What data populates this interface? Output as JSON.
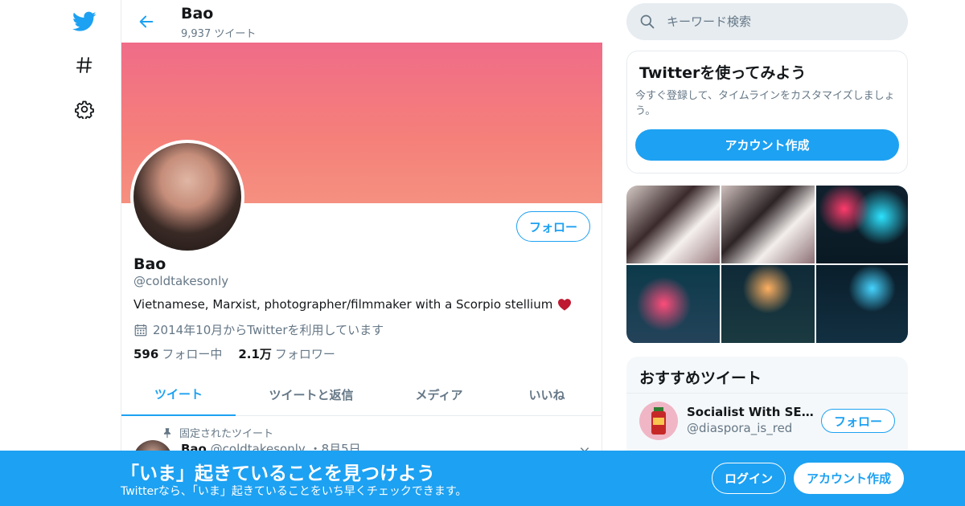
{
  "colors": {
    "accent": "#1da1f2",
    "muted": "#657786",
    "heart": "#be1931"
  },
  "header": {
    "title": "Bao",
    "tweet_count": "9,937 ツイート"
  },
  "profile": {
    "name": "Bao",
    "handle": "@coldtakesonly",
    "bio": "Vietnamese, Marxist, photographer/filmmaker with a Scorpio stellium",
    "joined": "2014年10月からTwitterを利用しています",
    "following_count": "596",
    "following_label": "フォロー中",
    "followers_count": "2.1万",
    "followers_label": "フォロワー",
    "follow_label": "フォロー"
  },
  "tabs": [
    {
      "label": "ツイート",
      "active": true
    },
    {
      "label": "ツイートと返信",
      "active": false
    },
    {
      "label": "メディア",
      "active": false
    },
    {
      "label": "いいね",
      "active": false
    }
  ],
  "pinned": {
    "label": "固定されたツイート",
    "author": "Bao",
    "handle": "@coldtakesonly",
    "date": "・8月5日"
  },
  "search": {
    "placeholder": "キーワード検索"
  },
  "signup_card": {
    "title": "Twitterを使ってみよう",
    "description": "今すぐ登録して、タイムラインをカスタマイズしましょう。",
    "button": "アカウント作成"
  },
  "recommended": {
    "title": "おすすめツイート",
    "name": "Socialist With SE Asi...",
    "handle": "@diaspora_is_red",
    "follow_label": "フォロー"
  },
  "bottom_bar": {
    "title": "「いま」起きていることを見つけよう",
    "subtitle": "Twitterなら、「いま」起きていることをいち早くチェックできます。",
    "login": "ログイン",
    "signup": "アカウント作成"
  },
  "icons": {
    "logo": "twitter-bird-icon",
    "explore": "hashtag-icon",
    "settings": "gear-icon",
    "back": "back-arrow-icon",
    "search": "search-icon",
    "calendar": "calendar-icon",
    "pin": "pin-icon",
    "heart": "heart-icon",
    "caret": "chevron-down-icon"
  }
}
